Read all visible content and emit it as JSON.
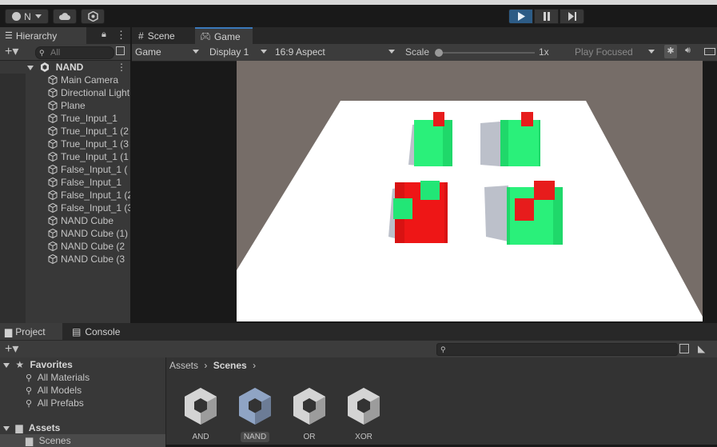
{
  "toolbar": {
    "account_label": "N",
    "play_state": "playing"
  },
  "hierarchy": {
    "tab_label": "Hierarchy",
    "search_placeholder": "All",
    "scene_name": "NAND",
    "items": [
      "Main Camera",
      "Directional Light",
      "Plane",
      "True_Input_1",
      "True_Input_1 (2",
      "True_Input_1 (3",
      "True_Input_1 (1",
      "False_Input_1 (",
      "False_Input_1",
      "False_Input_1 (2",
      "False_Input_1 (3",
      "NAND Cube",
      "NAND Cube (1)",
      "NAND Cube (2",
      "NAND Cube (3"
    ]
  },
  "game_view": {
    "tabs": [
      "Scene",
      "Game"
    ],
    "active_tab": "Game",
    "view_mode": "Game",
    "display": "Display 1",
    "aspect": "16:9 Aspect",
    "scale_label": "Scale",
    "scale_value": "1x",
    "play_mode": "Play Focused",
    "colors": {
      "true_cube": "#22ee77",
      "false_cube": "#ee1111",
      "floor": "#ffffff",
      "background": "#766d68"
    }
  },
  "project": {
    "tabs": [
      "Project",
      "Console"
    ],
    "active_tab": "Project",
    "favorites_label": "Favorites",
    "favorites": [
      "All Materials",
      "All Models",
      "All Prefabs"
    ],
    "assets_label": "Assets",
    "assets_children": [
      "Scenes"
    ],
    "breadcrumb": [
      "Assets",
      "Scenes"
    ],
    "scene_assets": [
      {
        "name": "AND",
        "selected": false
      },
      {
        "name": "NAND",
        "selected": true
      },
      {
        "name": "OR",
        "selected": false
      },
      {
        "name": "XOR",
        "selected": false
      }
    ]
  }
}
